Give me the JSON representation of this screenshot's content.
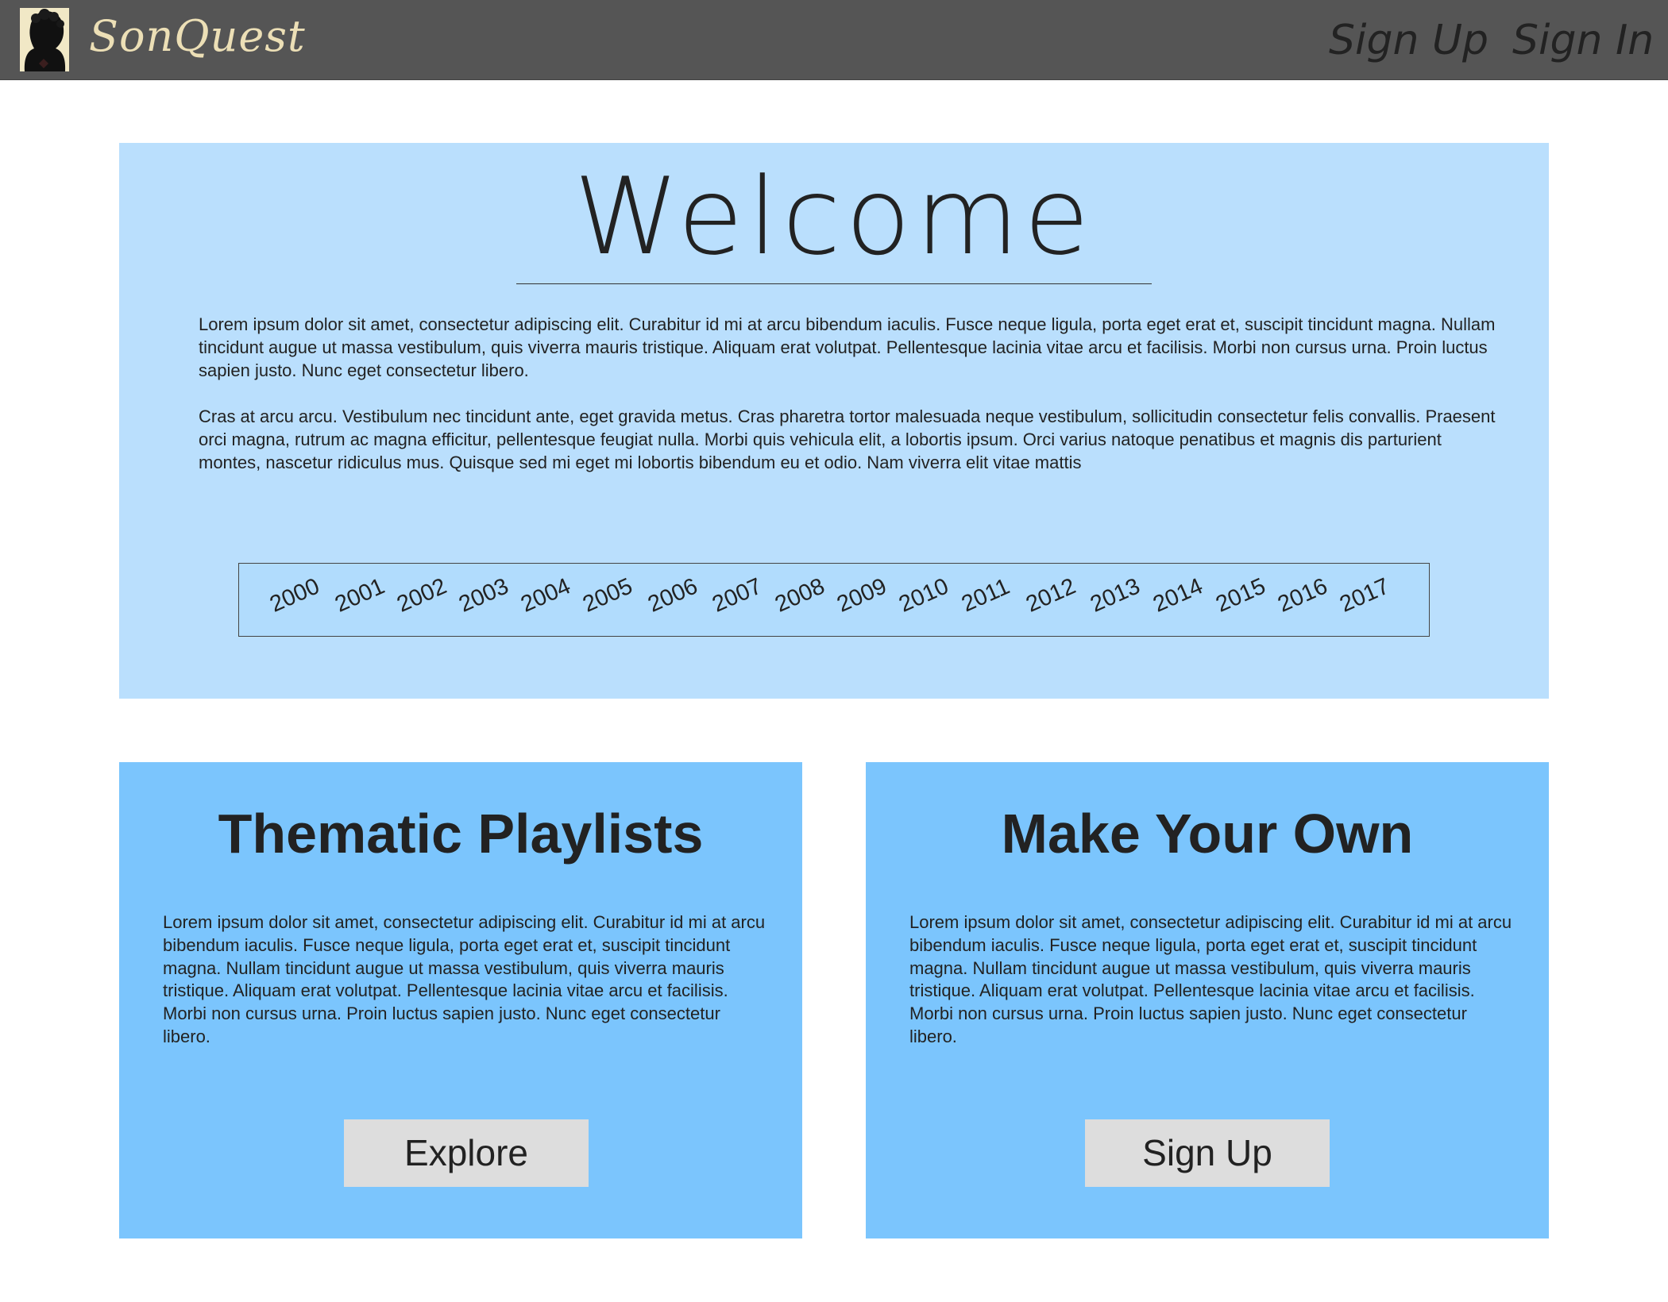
{
  "navbar": {
    "brand": "SonQuest",
    "sign_up": "Sign Up",
    "sign_in": "Sign In"
  },
  "welcome": {
    "title": "Welcome",
    "paragraphs": [
      "Lorem ipsum dolor sit amet, consectetur adipiscing elit. Curabitur id mi at arcu bibendum iaculis. Fusce neque ligula, porta eget erat et, suscipit tincidunt magna. Nullam tincidunt augue ut massa vestibulum, quis viverra mauris tristique. Aliquam erat volutpat. Pellentesque lacinia vitae arcu et facilisis. Morbi non cursus urna. Proin luctus sapien justo. Nunc eget consectetur libero.",
      "Cras at arcu arcu. Vestibulum nec tincidunt ante, eget gravida metus. Cras pharetra tortor malesuada neque vestibulum, sollicitudin consectetur felis convallis. Praesent orci magna, rutrum ac magna efficitur, pellentesque feugiat nulla. Morbi quis vehicula elit, a lobortis ipsum. Orci varius natoque penatibus et magnis dis parturient montes, nascetur ridiculus mus. Quisque sed mi eget mi lobortis bibendum eu et odio. Nam viverra elit vitae mattis"
    ],
    "years": [
      "2000",
      "2001",
      "2002",
      "2003",
      "2004",
      "2005",
      "2006",
      "2007",
      "2008",
      "2009",
      "2010",
      "2011",
      "2012",
      "2013",
      "2014",
      "2015",
      "2016",
      "2017"
    ]
  },
  "cards": [
    {
      "title": "Thematic Playlists",
      "text": "Lorem ipsum dolor sit amet, consectetur adipiscing elit. Curabitur id mi at arcu bibendum iaculis. Fusce neque ligula, porta eget erat et, suscipit tincidunt magna. Nullam tincidunt augue ut massa vestibulum, quis viverra mauris tristique. Aliquam erat volutpat. Pellentesque lacinia vitae arcu et facilisis. Morbi non cursus urna. Proin luctus sapien justo. Nunc eget consectetur libero.",
      "button": "Explore"
    },
    {
      "title": "Make Your Own",
      "text": "Lorem ipsum dolor sit amet, consectetur adipiscing elit. Curabitur id mi at arcu bibendum iaculis. Fusce neque ligula, porta eget erat et, suscipit tincidunt magna. Nullam tincidunt augue ut massa vestibulum, quis viverra mauris tristique. Aliquam erat volutpat. Pellentesque lacinia vitae arcu et facilisis. Morbi non cursus urna. Proin luctus sapien justo. Nunc eget consectetur libero.",
      "button": "Sign Up"
    }
  ],
  "colors": {
    "navbar": "#555555",
    "brand": "#ecdfb6",
    "welcome_panel": "#badffd",
    "years_strip": "#b1dcfd",
    "card": "#7bc5fd",
    "button": "#dddddd",
    "text": "#222222"
  },
  "icons": {
    "logo": "portrait-logo-icon"
  }
}
